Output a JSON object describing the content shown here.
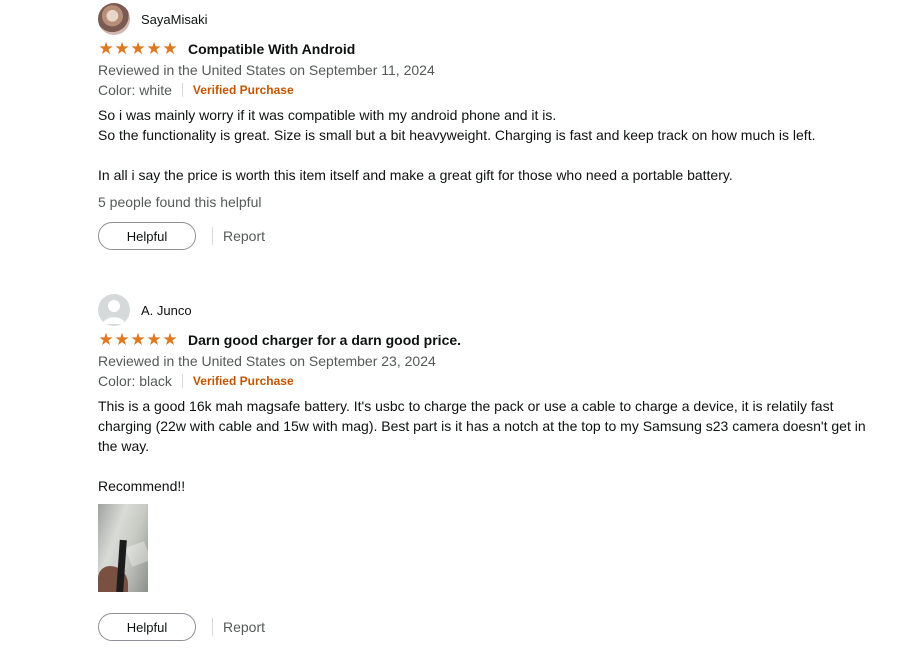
{
  "reviews": [
    {
      "author": "SayaMisaki",
      "stars_label": "★★★★★",
      "rating": 5,
      "title": "Compatible With Android",
      "reviewed": "Reviewed in the United States on September 11, 2024",
      "color": "Color: white",
      "verified": "Verified Purchase",
      "body": [
        "So i was mainly worry if it was compatible with my android phone and it is.",
        "So the functionality is great. Size is small but a bit heavyweight. Charging is fast and keep track on how much is left.",
        "",
        "In all i say the price is worth this item itself and make a great gift for those who need a portable battery."
      ],
      "helpful_count": "5 people found this helpful",
      "helpful_button": "Helpful",
      "report": "Report"
    },
    {
      "author": "A. Junco",
      "stars_label": "★★★★★",
      "rating": 5,
      "title": "Darn good charger for a darn good price.",
      "reviewed": "Reviewed in the United States on September 23, 2024",
      "color": "Color: black",
      "verified": "Verified Purchase",
      "body": [
        "This is a good 16k mah magsafe battery. It's usbc to charge the pack or use a cable to charge a device, it is relatily fast charging (22w with cable and 15w with mag). Best part is it has a notch at the top to my Samsung s23 camera doesn't get in the way.",
        "",
        "Recommend!!"
      ],
      "helpful_button": "Helpful",
      "report": "Report"
    }
  ],
  "colors": {
    "star": "#de7921",
    "verified": "#c45500",
    "muted": "#565959"
  },
  "icons": {
    "default_avatar": "person-silhouette-icon",
    "star": "star-icon"
  }
}
